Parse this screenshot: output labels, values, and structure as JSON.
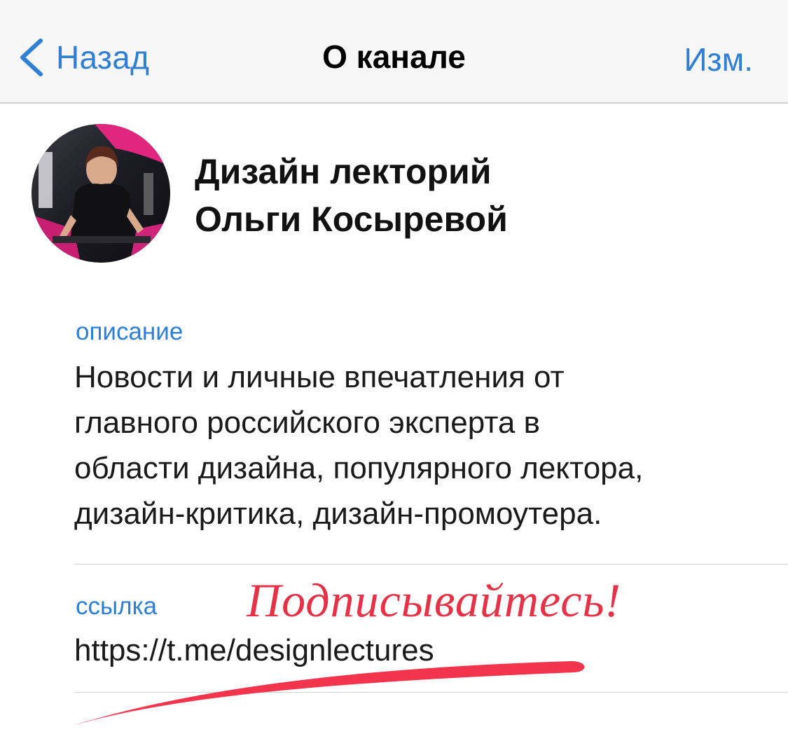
{
  "navbar": {
    "back_label": "Назад",
    "title": "О канале",
    "edit_label": "Изм."
  },
  "channel": {
    "name_line1": "Дизайн лекторий",
    "name_line2": "Ольги Косыревой"
  },
  "description": {
    "label": "описание",
    "lines": [
      "Новости и личные впечатления от",
      "главного российского эксперта в",
      "области дизайна, популярного лектора,",
      "дизайн-критика, дизайн-промоутера."
    ]
  },
  "link": {
    "label": "ссылка",
    "value": "https://t.me/designlectures"
  },
  "annotation": {
    "text": "Подписывайтесь!",
    "color": "#e63247"
  },
  "colors": {
    "accent": "#2f7fd6",
    "annotation_red": "#e63247"
  }
}
